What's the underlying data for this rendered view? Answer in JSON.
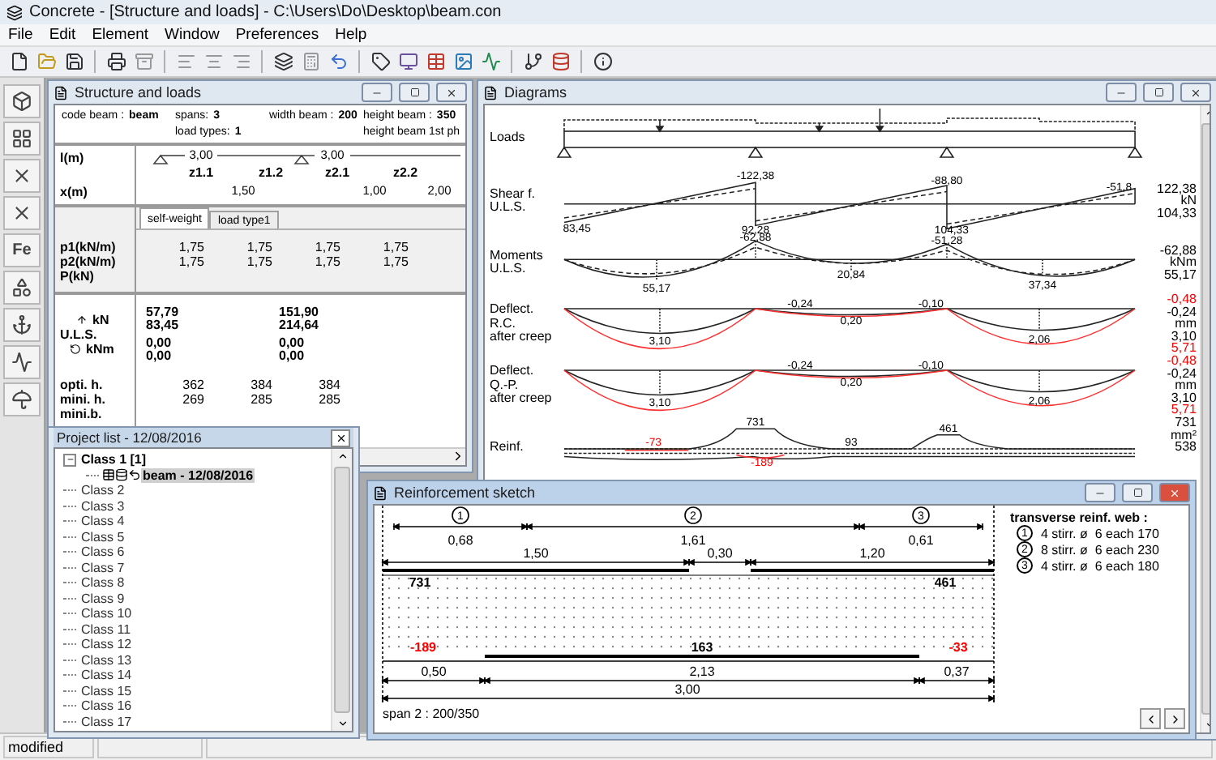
{
  "window": {
    "title": "Concrete - [Structure and loads] - C:\\Users\\Do\\Desktop\\beam.con"
  },
  "menu": [
    "File",
    "Edit",
    "Element",
    "Window",
    "Preferences",
    "Help"
  ],
  "side_toolbar": {
    "text_button": "Fe"
  },
  "structure": {
    "title": "Structure and loads",
    "header_rows": [
      [
        {
          "label": "code beam :",
          "value": "beam"
        },
        {
          "label": "spans:",
          "value": "3"
        },
        {
          "label": "width beam :",
          "value": "200"
        },
        {
          "label": "height beam :",
          "value": "350"
        }
      ],
      [
        {
          "label": "load types:",
          "value": "1"
        },
        {
          "label": "height beam 1st ph"
        }
      ]
    ],
    "geometry": {
      "length_label": "l(m)",
      "position_label": "x(m)",
      "spans": [
        "3,00",
        "3,00"
      ],
      "zones": [
        "z1.1",
        "z1.2",
        "z2.1",
        "z2.2"
      ],
      "positions": [
        "1,50",
        "1,00",
        "2,00"
      ]
    },
    "load_tabs": [
      {
        "label": "self-weight",
        "selected": true
      },
      {
        "label": "load type1",
        "selected": false
      }
    ],
    "loads": [
      {
        "label": "p1(kN/m)",
        "values": [
          "1,75",
          "1,75",
          "1,75",
          "1,75"
        ]
      },
      {
        "label": "p2(kN/m)",
        "values": [
          "1,75",
          "1,75",
          "1,75",
          "1,75"
        ]
      },
      {
        "label": "P(kN)"
      }
    ],
    "reactions": {
      "force_unit": "kN",
      "state": "U.L.S.",
      "moment_unit": "kNm",
      "supports": [
        {
          "force": [
            "57,79",
            "83,45"
          ],
          "moment": [
            "0,00",
            "0,00"
          ]
        },
        {
          "force": [
            "151,90",
            "214,64"
          ],
          "moment": [
            "0,00",
            "0,00"
          ]
        }
      ]
    },
    "heights": [
      {
        "label": "opti. h.",
        "values": [
          "362",
          "384",
          "384"
        ]
      },
      {
        "label": "mini. h.",
        "values": [
          "269",
          "285",
          "285"
        ]
      },
      {
        "label": "mini.b."
      }
    ]
  },
  "project_list": {
    "title": "Project list - 12/08/2016",
    "tree": [
      {
        "label": "Class 1 [1]",
        "expanded": true,
        "selected": false,
        "children": [
          {
            "label": "beam - 12/08/2016",
            "selected": true
          }
        ]
      },
      {
        "label": "Class 2",
        "expanded": false,
        "selected": false
      },
      {
        "label": "Class 3",
        "expanded": false,
        "selected": false
      },
      {
        "label": "Class 4",
        "expanded": false,
        "selected": false
      },
      {
        "label": "Class 5",
        "expanded": false,
        "selected": false
      },
      {
        "label": "Class 6",
        "expanded": false,
        "selected": false
      },
      {
        "label": "Class 7",
        "expanded": false,
        "selected": false
      },
      {
        "label": "Class 8",
        "expanded": false,
        "selected": false
      },
      {
        "label": "Class 9",
        "expanded": false,
        "selected": false
      },
      {
        "label": "Class 10",
        "expanded": false,
        "selected": false
      },
      {
        "label": "Class 11",
        "expanded": false,
        "selected": false
      },
      {
        "label": "Class 12",
        "expanded": false,
        "selected": false
      },
      {
        "label": "Class 13",
        "expanded": false,
        "selected": false
      },
      {
        "label": "Class 14",
        "expanded": false,
        "selected": false
      },
      {
        "label": "Class 15",
        "expanded": false,
        "selected": false
      },
      {
        "label": "Class 16",
        "expanded": false,
        "selected": false
      },
      {
        "label": "Class 17",
        "expanded": false,
        "selected": false
      }
    ]
  },
  "diagrams": {
    "title": "Diagrams",
    "rows": [
      {
        "kind": "loads",
        "label": [
          "Loads"
        ]
      },
      {
        "kind": "shear",
        "label": [
          "Shear f.",
          "U.L.S."
        ],
        "values": [
          {
            "text": "-122,38"
          },
          {
            "text": "-88,80"
          },
          {
            "text": "-51,8"
          },
          {
            "text": "83,45"
          },
          {
            "text": "92,28"
          },
          {
            "text": "104,33"
          }
        ],
        "readings": [
          {
            "text": "122,38"
          },
          {
            "text": "kN"
          },
          {
            "text": "104,33"
          }
        ]
      },
      {
        "kind": "moment",
        "label": [
          "Moments",
          "U.L.S."
        ],
        "values": [
          {
            "text": "-62,88"
          },
          {
            "text": "-51,28"
          },
          {
            "text": "55,17"
          },
          {
            "text": "20,84"
          },
          {
            "text": "37,34"
          }
        ],
        "readings": [
          {
            "text": "-62,88"
          },
          {
            "text": "kNm"
          },
          {
            "text": "55,17"
          }
        ]
      },
      {
        "kind": "deflection",
        "label": [
          "Deflect.",
          "R.C.",
          "after creep"
        ],
        "values": [
          {
            "text": "-0,24"
          },
          {
            "text": "-0,10"
          },
          {
            "text": "0,20"
          },
          {
            "text": "3,10"
          },
          {
            "text": "2,06"
          }
        ],
        "readings": [
          {
            "text": "-0,48",
            "color": "#ff0000"
          },
          {
            "text": "-0,24",
            "color": "#000000"
          },
          {
            "text": "mm",
            "color": "#000000"
          },
          {
            "text": "3,10",
            "color": "#000000"
          },
          {
            "text": "5,71",
            "color": "#ff0000"
          }
        ]
      },
      {
        "kind": "deflection",
        "label": [
          "Deflect.",
          "Q.-P.",
          "after creep"
        ],
        "values": [
          {
            "text": "-0,24"
          },
          {
            "text": "-0,10"
          },
          {
            "text": "0,20"
          },
          {
            "text": "3,10"
          },
          {
            "text": "2,06"
          }
        ],
        "readings": [
          {
            "text": "-0,48",
            "color": "#ff0000"
          },
          {
            "text": "-0,24",
            "color": "#000000"
          },
          {
            "text": "mm",
            "color": "#000000"
          },
          {
            "text": "3,10",
            "color": "#000000"
          },
          {
            "text": "5,71",
            "color": "#ff0000"
          }
        ]
      },
      {
        "kind": "reinforcement",
        "label": [
          "Reinf."
        ],
        "values": [
          {
            "text": "731",
            "color": "#000000"
          },
          {
            "text": "461",
            "color": "#000000"
          },
          {
            "text": "93",
            "color": "#000000"
          },
          {
            "text": "-73",
            "color": "#ff0000"
          },
          {
            "text": "-189",
            "color": "#ff0000"
          }
        ],
        "readings": [
          {
            "text": "731"
          },
          {
            "text": "mm²"
          },
          {
            "text": "538"
          }
        ]
      }
    ]
  },
  "sketch": {
    "title": "Reinforcement sketch",
    "stirrup_zones": [
      "1",
      "2",
      "3"
    ],
    "stirrup_lengths": [
      "0,68",
      "1,61",
      "0,61"
    ],
    "top_lengths": [
      "1,50",
      "0,30",
      "1,20"
    ],
    "top_areas": [
      "731",
      "461"
    ],
    "bottom_areas": [
      {
        "text": "-189",
        "color": "#ff0000"
      },
      {
        "text": "163",
        "color": "#000000"
      },
      {
        "text": "-33",
        "color": "#ff0000"
      }
    ],
    "bottom_lengths": [
      "0,50",
      "2,13",
      "0,37"
    ],
    "total_length": "3,00",
    "caption": "span 2 : 200/350",
    "legend_title": "transverse reinf. web :",
    "legend": [
      {
        "number": "1",
        "text": "4 stirr. ø  6 each 170"
      },
      {
        "number": "2",
        "text": "8 stirr. ø  6 each 230"
      },
      {
        "number": "3",
        "text": "4 stirr. ø  6 each 180"
      }
    ]
  },
  "status_bar": [
    "modified"
  ]
}
